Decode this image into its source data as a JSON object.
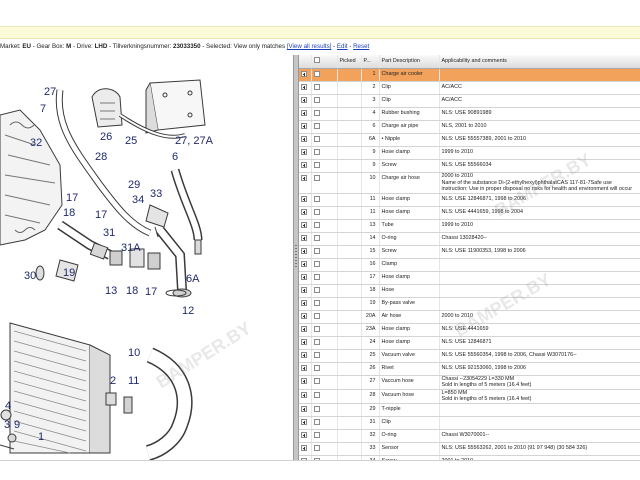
{
  "filter_bar": {
    "market_label": "Market:",
    "market_value": "EU",
    "gearbox_label": " - Gear Box:",
    "gearbox_value": "M",
    "drive_label": " - Drive:",
    "drive_value": "LHD",
    "serial_label": " - Tillverkningsnummer:",
    "serial_value": "23033350",
    "selected_label": " - Selected:",
    "selected_value": "View only matches",
    "view_all_link": "[View all results]",
    "edit_link": "Edit",
    "reset_link": "Reset",
    "separator": " - "
  },
  "parts_table": {
    "headers": {
      "picked": "Picked",
      "pos": "P...",
      "description": "Part Description",
      "comments": "Applicability and comments"
    },
    "rows": [
      {
        "pos": "1",
        "desc": "Charge air cooler",
        "comment": "",
        "selected": true
      },
      {
        "pos": "2",
        "desc": "Clip",
        "comment": "AC/ACC"
      },
      {
        "pos": "3",
        "desc": "Clip",
        "comment": "AC/ACC"
      },
      {
        "pos": "4",
        "desc": "Rubber bushing",
        "comment": "NLS: USE 90891989"
      },
      {
        "pos": "6",
        "desc": "Charge air pipe",
        "comment": "NLS, 2001 to 2010"
      },
      {
        "pos": "6A",
        "desc": "• Nipple",
        "comment": "NLS: USE 55557389, 2001 to 2010"
      },
      {
        "pos": "9",
        "desc": "Hose clamp",
        "comment": "1999 to 2010"
      },
      {
        "pos": "9",
        "desc": "Screw",
        "comment": "NLS: USE 55566034"
      },
      {
        "pos": "10",
        "desc": "Charge air hose",
        "comment": "2000 to 2010",
        "comment2": "Name of the substance Di-(2-ethylhexyl)phthalatCAS 117-81-7Safe use instruction: Use in proper disposal no risks for health and environment will occur",
        "tall": true
      },
      {
        "pos": "11",
        "desc": "Hose clamp",
        "comment": "NLS: USE 12846871, 1998 to 2006"
      },
      {
        "pos": "11",
        "desc": "Hose clamp",
        "comment": "NLS: USE 4441659, 1998 to 2004"
      },
      {
        "pos": "13",
        "desc": "Tube",
        "comment": "1999 to 2010"
      },
      {
        "pos": "14",
        "desc": "O-ring",
        "comment": "Chassi 13028420--"
      },
      {
        "pos": "15",
        "desc": "Screw",
        "comment": "NLS: USE 11900353, 1998 to 2006"
      },
      {
        "pos": "16",
        "desc": "Clamp",
        "comment": ""
      },
      {
        "pos": "17",
        "desc": "Hose clamp",
        "comment": ""
      },
      {
        "pos": "18",
        "desc": "Hose",
        "comment": ""
      },
      {
        "pos": "19",
        "desc": "By-pass valve",
        "comment": ""
      },
      {
        "pos": "20A",
        "desc": "Air hose",
        "comment": "2000 to 2010"
      },
      {
        "pos": "23A",
        "desc": "Hose clamp",
        "comment": "NLS: USE 4441659"
      },
      {
        "pos": "24",
        "desc": "Hose clamp",
        "comment": "NLS: USE 12846871"
      },
      {
        "pos": "25",
        "desc": "Vacuum valve",
        "comment": "NLS: USE 55560354, 1998 to 2006, Chassi W3070176--"
      },
      {
        "pos": "26",
        "desc": "Rivet",
        "comment": "NLS: USE 92153060, 1998 to 2006"
      },
      {
        "pos": "27",
        "desc": "Vaccum hose",
        "comment": "Chassi --23054229 L=330 MM",
        "comment2": "Sold in lengths of 5 meters (16.4 feet)",
        "tall": true
      },
      {
        "pos": "28",
        "desc": "Vacuum hose",
        "comment": "L=850 MM",
        "comment2": "Sold in lengths of 5 meters (16.4 feet)",
        "tall": true
      },
      {
        "pos": "29",
        "desc": "T-nipple",
        "comment": ""
      },
      {
        "pos": "31",
        "desc": "Clip",
        "comment": ""
      },
      {
        "pos": "32",
        "desc": "O-ring",
        "comment": "Chassi W3070001--"
      },
      {
        "pos": "33",
        "desc": "Sensor",
        "comment": "NLS: USE 55563262, 2001 to 2010 (91 97 948) (30 584 326)"
      },
      {
        "pos": "34",
        "desc": "Screw",
        "comment": "2001 to 2010"
      }
    ]
  },
  "diagram": {
    "callouts": [
      "27",
      "7",
      "26",
      "25",
      "27, 27A",
      "6",
      "32",
      "28",
      "29",
      "33",
      "34",
      "17",
      "17",
      "18",
      "31",
      "31A",
      "6A",
      "30",
      "19",
      "13",
      "18",
      "17",
      "12",
      "10",
      "2",
      "11",
      "4",
      "3",
      "1",
      "9"
    ],
    "colors": {
      "line": "#3a3a3a",
      "callout": "#1f2a6b"
    }
  },
  "watermark": {
    "text": "BAMPER.BY"
  },
  "colors": {
    "selected_row": "#f2a25b",
    "link": "#1a3fb8",
    "yellow_band": "#fbfbd9"
  }
}
